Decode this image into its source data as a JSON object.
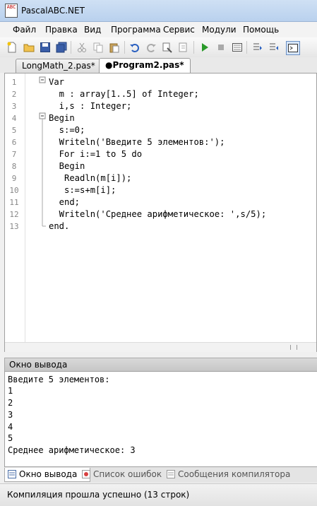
{
  "window": {
    "title": "PascalABC.NET",
    "icon": "ABC"
  },
  "menu": [
    "Файл",
    "Правка",
    "Вид",
    "Программа",
    "Сервис",
    "Модули",
    "Помощь"
  ],
  "toolbar_icons": [
    "new-file-icon",
    "open-folder-icon",
    "save-icon",
    "save-all-icon",
    "cut-icon",
    "copy-icon",
    "paste-icon",
    "undo-icon",
    "redo-icon",
    "find-icon",
    "replace-icon",
    "run-icon",
    "stop-icon",
    "console-icon",
    "step-into-icon",
    "step-over-icon",
    "output-toggle-icon"
  ],
  "tabs": [
    {
      "label": "LongMath_2.pas*",
      "active": false
    },
    {
      "label": "●Program2.pas*",
      "active": true
    }
  ],
  "code": [
    {
      "n": "1",
      "text": "Var"
    },
    {
      "n": "2",
      "text": "  m : array[1..5] of Integer;"
    },
    {
      "n": "3",
      "text": "  i,s : Integer;"
    },
    {
      "n": "4",
      "text": "Begin"
    },
    {
      "n": "5",
      "text": "  s:=0;"
    },
    {
      "n": "6",
      "text": "  Writeln('Введите 5 элементов:');"
    },
    {
      "n": "7",
      "text": "  For i:=1 to 5 do"
    },
    {
      "n": "8",
      "text": "  Begin"
    },
    {
      "n": "9",
      "text": "   Readln(m[i]);"
    },
    {
      "n": "10",
      "text": "   s:=s+m[i];"
    },
    {
      "n": "11",
      "text": "  end;"
    },
    {
      "n": "12",
      "text": "  Writeln('Среднее арифметическое: ',s/5);"
    },
    {
      "n": "13",
      "text": "end."
    }
  ],
  "output": {
    "header": "Окно вывода",
    "lines": [
      "Введите 5 элементов:",
      "1",
      "2",
      "3",
      "4",
      "5",
      "Среднее арифметическое: 3"
    ]
  },
  "bottom_tabs": [
    {
      "label": "Окно вывода",
      "active": true,
      "icon": "output-window-icon"
    },
    {
      "label": "Список ошибок",
      "active": false,
      "icon": "error-list-icon"
    },
    {
      "label": "Сообщения компилятора",
      "active": false,
      "icon": "compiler-messages-icon"
    }
  ],
  "status": "Компиляция прошла успешно (13 строк)"
}
